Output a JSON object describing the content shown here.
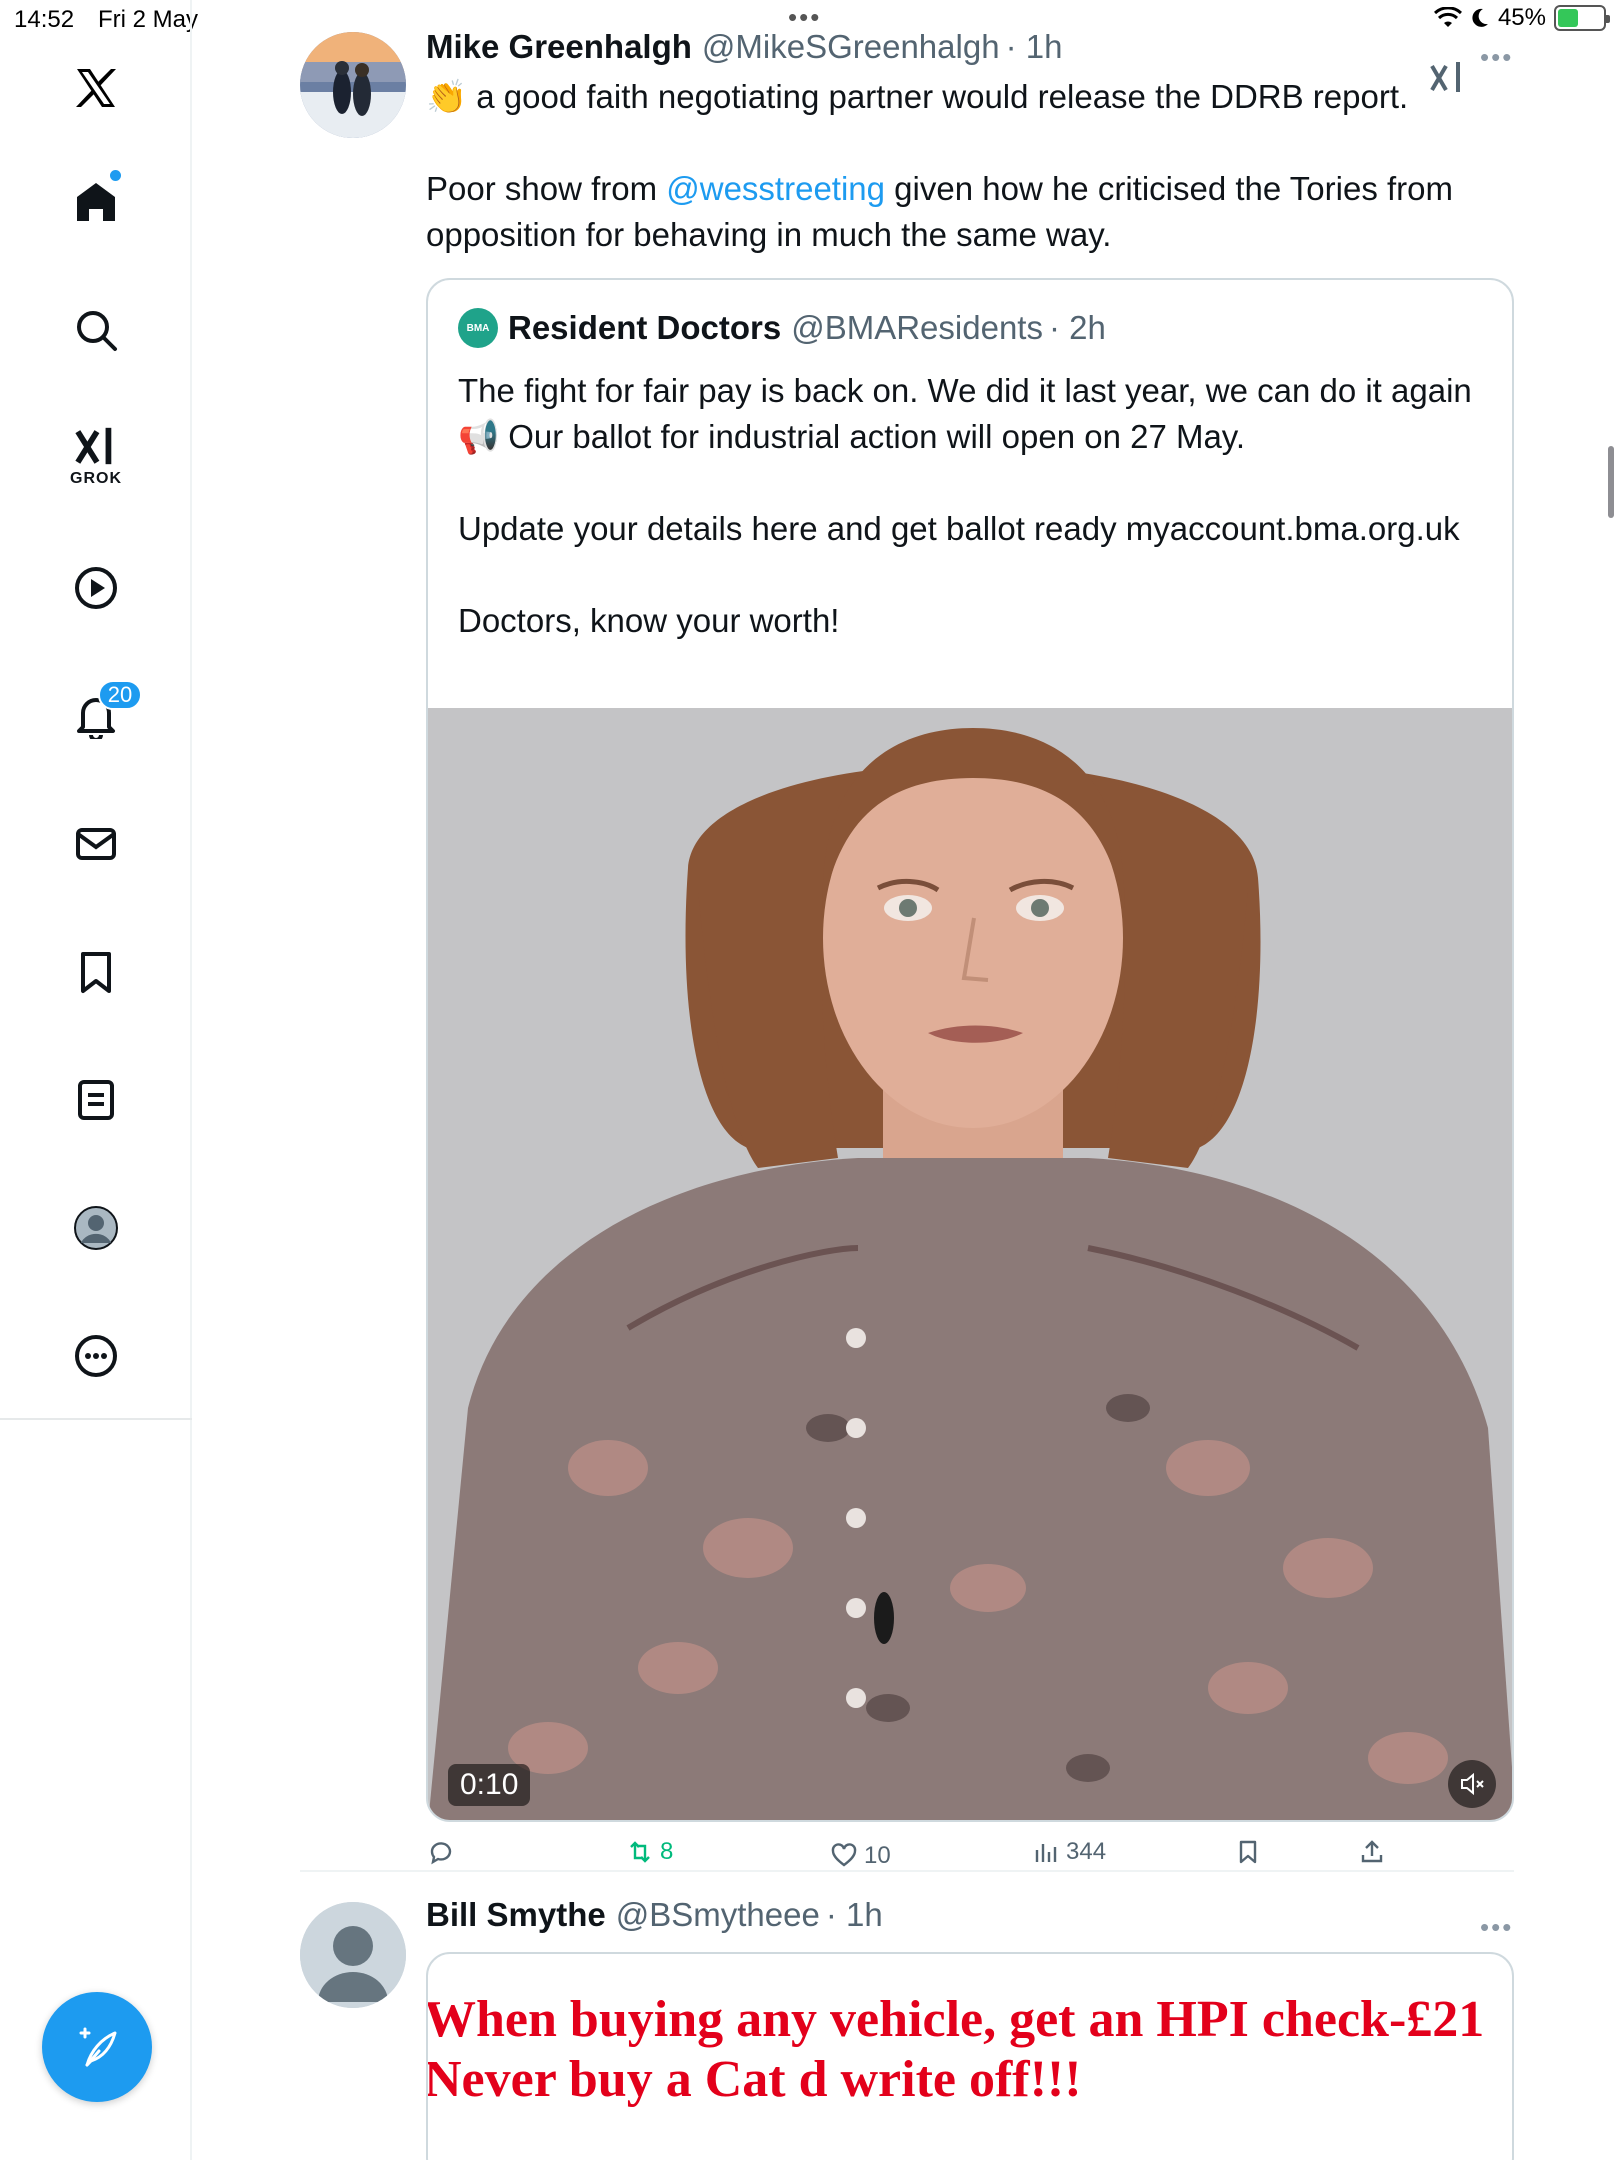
{
  "status_bar": {
    "time": "14:52",
    "date": "Fri 2 May",
    "battery": "45%",
    "battery_level": 0.45
  },
  "sidebar": {
    "items": [
      {
        "name": "x-logo",
        "label": ""
      },
      {
        "name": "home",
        "label": ""
      },
      {
        "name": "search",
        "label": ""
      },
      {
        "name": "grok",
        "label": "GROK"
      },
      {
        "name": "video",
        "label": ""
      },
      {
        "name": "notifications",
        "label": "",
        "badge": "20"
      },
      {
        "name": "messages",
        "label": ""
      },
      {
        "name": "bookmarks",
        "label": ""
      },
      {
        "name": "lists",
        "label": ""
      },
      {
        "name": "profile",
        "label": ""
      },
      {
        "name": "more",
        "label": ""
      }
    ],
    "notification_count": "20"
  },
  "colors": {
    "accent": "#1d9bf0",
    "retweet_green": "#00ba7c",
    "text_primary": "#0f1419",
    "text_secondary": "#536471"
  },
  "post": {
    "author_name": "Mike Greenhalgh",
    "author_handle": "@MikeSGreenhalgh",
    "time": "· 1h",
    "text_line1": " a good faith negotiating partner would release the DDRB report.",
    "text_emoji": "👏",
    "text_part1": "Poor show from ",
    "mention": "@wesstreeting",
    "text_part2": " given how he criticised the Tories from opposition for behaving in much the same way.",
    "quote": {
      "logo_text": "BMA",
      "author_name": "Resident Doctors",
      "author_handle": "@BMAResidents",
      "time": "· 2h",
      "text": "The fight for fair pay is back on. We did it last year, we can do it again 📢 Our ballot for industrial action will open on 27 May.\n\nUpdate your details here and get ballot ready myaccount.bma.org.uk\n\nDoctors, know your worth!",
      "video_time": "0:10"
    },
    "actions": {
      "reply_count": "",
      "retweet_count": "8",
      "like_count": "10",
      "view_count": "344"
    }
  },
  "post2": {
    "author_name": "Bill Smythe",
    "author_handle": "@BSmytheee",
    "time": "· 1h",
    "image_line1": "When buying any vehicle, get an HPI check-£21",
    "image_line2": "Never buy a Cat d write off!!!"
  }
}
